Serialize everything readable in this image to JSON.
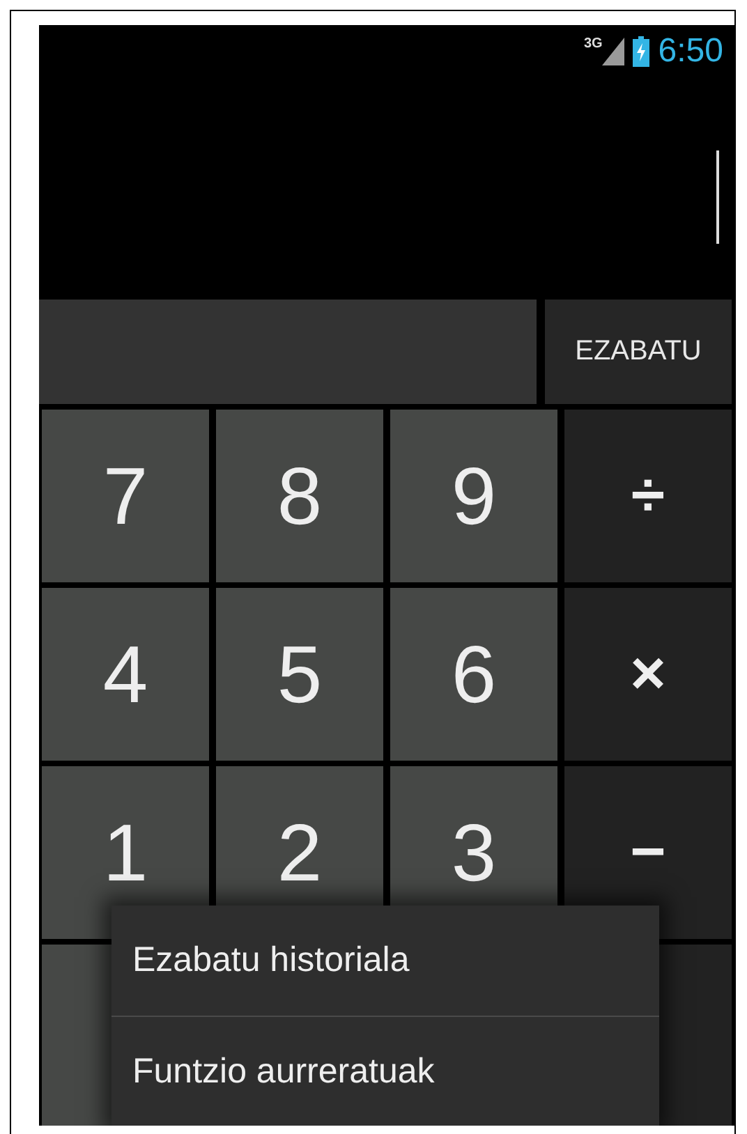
{
  "status_bar": {
    "network": "3G",
    "time": "6:50"
  },
  "display": {
    "clear_button": "EZABATU"
  },
  "keypad": [
    {
      "label": "7",
      "kind": "digit"
    },
    {
      "label": "8",
      "kind": "digit"
    },
    {
      "label": "9",
      "kind": "digit"
    },
    {
      "label": "÷",
      "kind": "operator"
    },
    {
      "label": "4",
      "kind": "digit"
    },
    {
      "label": "5",
      "kind": "digit"
    },
    {
      "label": "6",
      "kind": "digit"
    },
    {
      "label": "×",
      "kind": "operator"
    },
    {
      "label": "1",
      "kind": "digit"
    },
    {
      "label": "2",
      "kind": "digit"
    },
    {
      "label": "3",
      "kind": "digit"
    },
    {
      "label": "−",
      "kind": "operator"
    },
    {
      "kind": "digit"
    },
    {
      "kind": "operator"
    }
  ],
  "menu": {
    "items": [
      "Ezabatu historiala",
      "Funtzio aurreratuak"
    ]
  }
}
